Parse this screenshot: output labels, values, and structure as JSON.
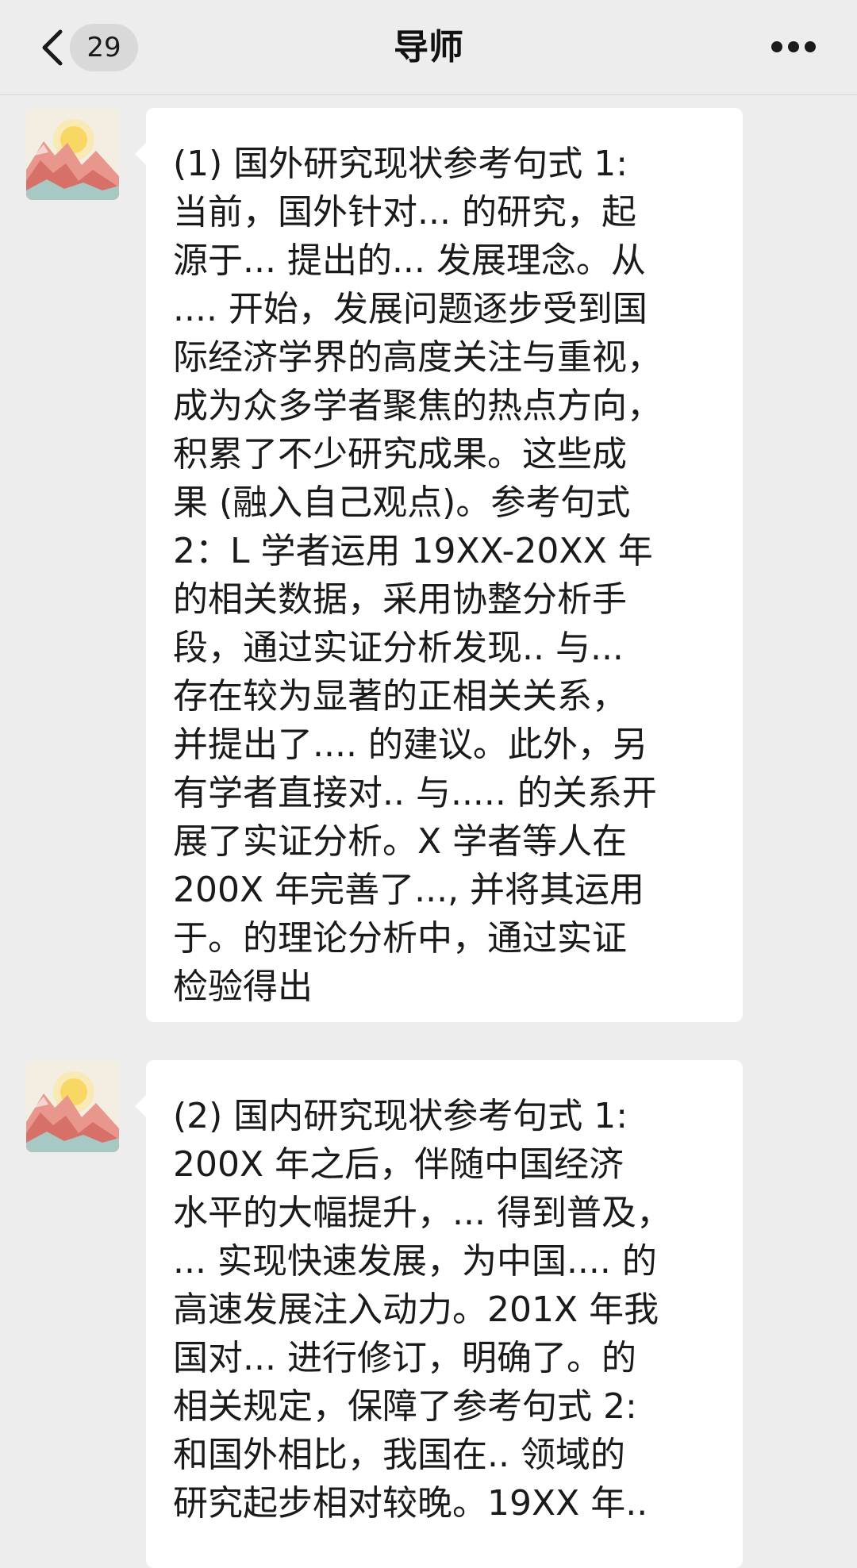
{
  "header": {
    "unread_count": "29",
    "title": "导师"
  },
  "messages": [
    {
      "sender": "导师",
      "text": "(1) 国外研究现状参考句式 1:\n当前，国外针对... 的研究，起\n源于... 提出的... 发展理念。从\n.... 开始，发展问题逐步受到国\n际经济学界的高度关注与重视，\n成为众多学者聚焦的热点方向，\n积累了不少研究成果。这些成\n果 (融入自己观点)。参考句式\n2：L 学者运用 19XX-20XX 年\n的相关数据，采用协整分析手\n段，通过实证分析发现.. 与...\n存在较为显著的正相关关系，\n并提出了.... 的建议。此外，另\n有学者直接对.. 与..... 的关系开\n展了实证分析。X 学者等人在\n200X 年完善了..., 并将其运用\n于。的理论分析中，通过实证\n检验得出"
    },
    {
      "sender": "导师",
      "text": "(2) 国内研究现状参考句式 1:\n200X 年之后，伴随中国经济\n水平的大幅提升，... 得到普及，\n... 实现快速发展，为中国.... 的\n高速发展注入动力。201X 年我\n国对... 进行修订，明确了。的\n相关规定，保障了参考句式 2:\n和国外相比，我国在.. 领域的\n研究起步相对较晚。19XX 年.."
    }
  ],
  "icons": {
    "back": "chevron-left-icon",
    "more": "more-dots-icon",
    "avatar": "landscape-sun-mountain-avatar"
  },
  "colors": {
    "background": "#ededed",
    "bubble": "#ffffff",
    "text": "#1a1a1a"
  }
}
